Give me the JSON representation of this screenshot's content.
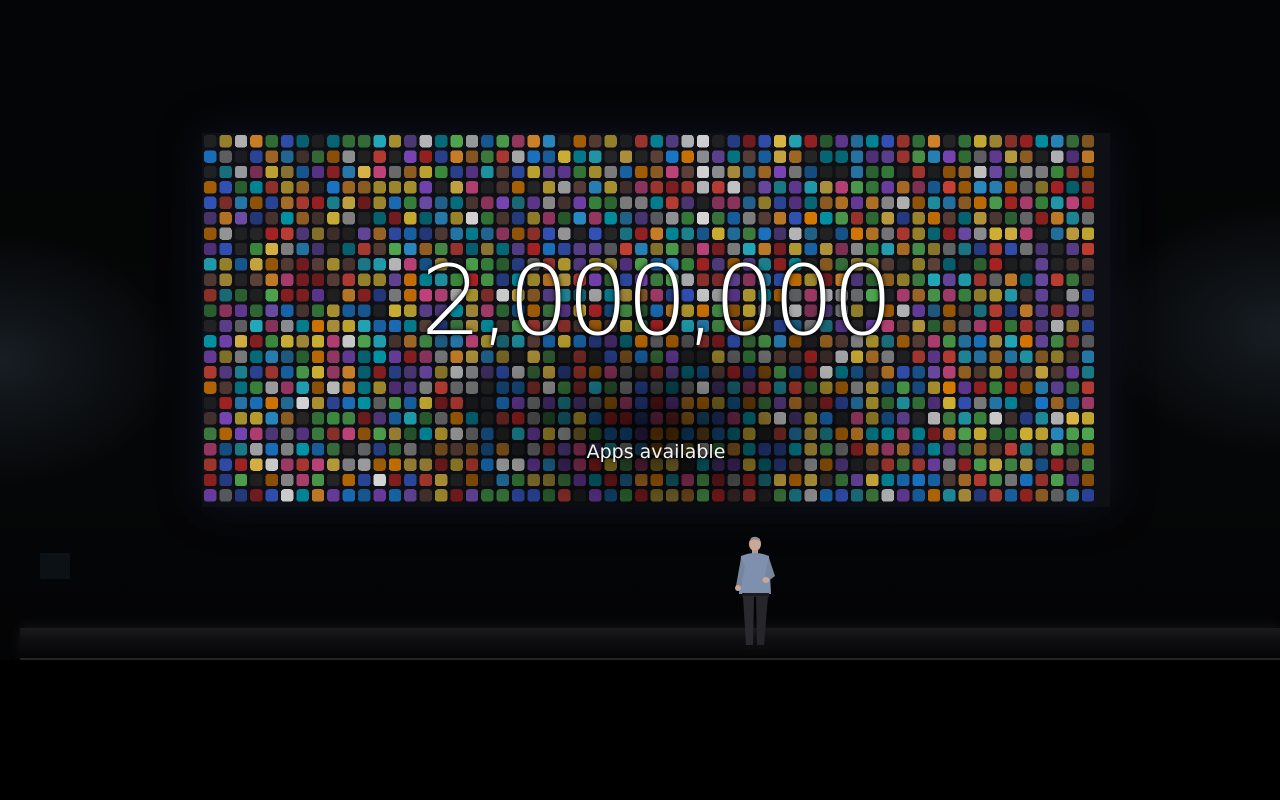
{
  "screen": {
    "headline": "2,000,000",
    "subline": "Apps available"
  },
  "colors": {
    "background": "#030304",
    "text": "#ffffff",
    "icon_palette": [
      "#e84a3c",
      "#f29a2e",
      "#f6d33c",
      "#5cc15b",
      "#2fa3e6",
      "#3a5fd6",
      "#8e4fd6",
      "#e24f8e",
      "#ffffff",
      "#2b2b2b",
      "#1e88e5",
      "#43a047",
      "#fb8c00",
      "#00acc1",
      "#c62828",
      "#6d4c41",
      "#9e9e9e",
      "#ffd54f",
      "#26c6da",
      "#7e57c2"
    ]
  }
}
